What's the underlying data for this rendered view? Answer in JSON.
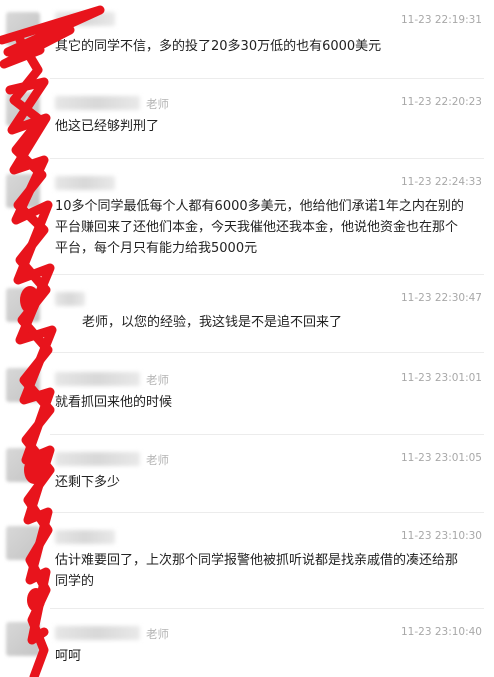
{
  "messages": [
    {
      "name_suffix": "",
      "time": "11-23 22:19:31",
      "text": "其它的同学不信，多的投了20多30万低的也有6000美元"
    },
    {
      "name_suffix": "老师",
      "time": "11-23 22:20:23",
      "text": "他这已经够判刑了"
    },
    {
      "name_suffix": "",
      "time": "11-23 22:24:33",
      "text": "10多个同学最低每个人都有6000多美元，他给他们承诺1年之内在别的平台赚回来了还他们本金，今天我催他还我本金，他说他资金也在那个平台，每个月只有能力给我5000元"
    },
    {
      "name_suffix": "",
      "time": "11-23 22:30:47",
      "text": "老师，以您的经验，我这钱是不是追不回来了"
    },
    {
      "name_suffix": "老师",
      "time": "11-23 23:01:01",
      "text": "就看抓回来他的时候"
    },
    {
      "name_suffix": "老师",
      "time": "11-23 23:01:05",
      "text": "还剩下多少"
    },
    {
      "name_suffix": "",
      "time": "11-23 23:10:30",
      "text": "估计难要回了，上次那个同学报警他被抓听说都是找亲戚借的凑还给那同学的"
    },
    {
      "name_suffix": "老师",
      "time": "11-23 23:10:40",
      "text": "呵呵"
    }
  ],
  "colors": {
    "redaction": "#e8141c",
    "separator": "#ececec",
    "meta": "#a8a8a8"
  }
}
